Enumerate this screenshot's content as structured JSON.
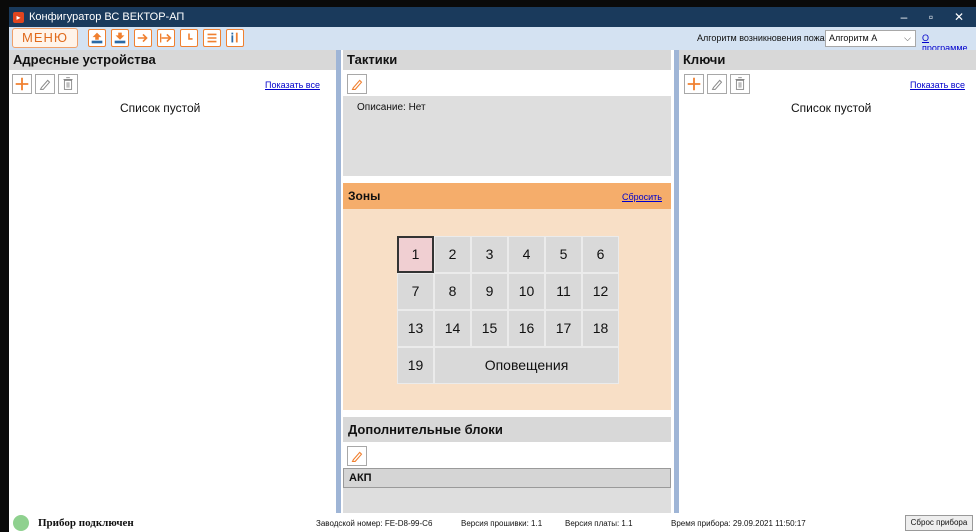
{
  "window": {
    "title": "Конфигуратор ВС ВЕКТОР-АП",
    "controls": {
      "minimize": "–",
      "maximize": "▫",
      "close": "✕"
    }
  },
  "toolbar": {
    "menu_label": "МЕНЮ",
    "icons": [
      "read-device-icon",
      "write-device-icon",
      "export-icon",
      "import-icon",
      "clock-icon",
      "list-icon",
      "info-icon"
    ],
    "algo_label": "Алгоритм возникновения пожара",
    "algo_value": "Алгоритм А",
    "about_link": "О программе"
  },
  "devices": {
    "title": "Адресные устройства",
    "show_all": "Показать все",
    "empty": "Список пустой"
  },
  "tactics": {
    "title": "Тактики",
    "description": "Описание: Нет"
  },
  "zones": {
    "title": "Зоны",
    "reset": "Сбросить",
    "cells": [
      "1",
      "2",
      "3",
      "4",
      "5",
      "6",
      "7",
      "8",
      "9",
      "10",
      "11",
      "12",
      "13",
      "14",
      "15",
      "16",
      "17",
      "18",
      "19"
    ],
    "alerts_label": "Оповещения",
    "selected": "1"
  },
  "extra": {
    "title": "Дополнительные блоки",
    "row": "АКП"
  },
  "keys": {
    "title": "Ключи",
    "show_all": "Показать все",
    "empty": "Список пустой"
  },
  "status": {
    "connection": "Прибор подключен",
    "serial": "Заводской номер: FE-D8-99-C6",
    "firmware": "Версия прошивки: 1.1",
    "board": "Версия платы: 1.1",
    "device_time": "Время прибора: 29.09.2021 11:50:17",
    "reset_button": "Сброс прибора"
  },
  "colors": {
    "title_bar": "#1a3a5c",
    "accent_orange": "#f08030",
    "zones_header": "#f5ad6b",
    "zones_body": "#f8dfc6",
    "status_ok": "#8fd18f"
  }
}
